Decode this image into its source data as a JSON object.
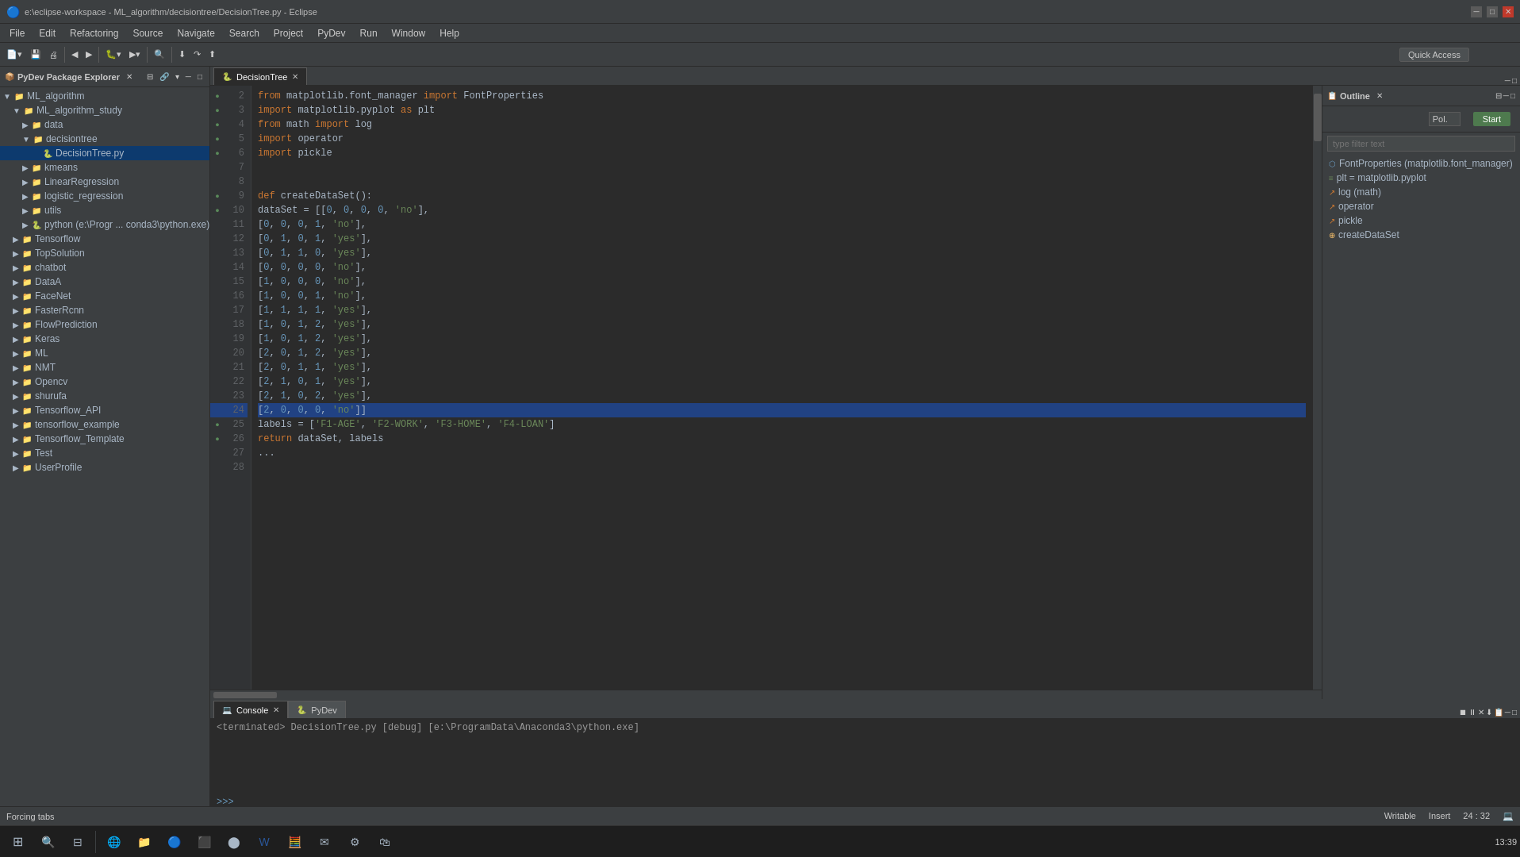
{
  "window": {
    "title": "e:\\eclipse-workspace - ML_algorithm/decisiontree/DecisionTree.py - Eclipse",
    "icon": "eclipse-icon"
  },
  "titlebar": {
    "text": "e:\\eclipse-workspace - ML_algorithm/decisiontree/DecisionTree.py - Eclipse"
  },
  "menubar": {
    "items": [
      "File",
      "Edit",
      "Refactoring",
      "Source",
      "Navigate",
      "Search",
      "Project",
      "PyDev",
      "Run",
      "Window",
      "Help"
    ]
  },
  "tabs": {
    "editor_tab": "DecisionTree",
    "console_tab": "Console",
    "pydev_tab": "PyDev"
  },
  "quick_access": {
    "label": "Quick Access",
    "placeholder": "Quick Access"
  },
  "sidebar": {
    "title": "PyDev Package Explorer",
    "items": [
      {
        "label": "ML_algorithm",
        "level": 1,
        "type": "folder",
        "expanded": true
      },
      {
        "label": "ML_algorithm_study",
        "level": 2,
        "type": "folder",
        "expanded": true
      },
      {
        "label": "data",
        "level": 3,
        "type": "folder",
        "expanded": false
      },
      {
        "label": "decisiontree",
        "level": 3,
        "type": "folder",
        "expanded": true
      },
      {
        "label": "DecisionTree.py",
        "level": 4,
        "type": "pyfile",
        "selected": true
      },
      {
        "label": "kmeans",
        "level": 3,
        "type": "folder",
        "expanded": false
      },
      {
        "label": "LinearRegression",
        "level": 3,
        "type": "folder",
        "expanded": false
      },
      {
        "label": "logistic_regression",
        "level": 3,
        "type": "folder",
        "expanded": false
      },
      {
        "label": "utils",
        "level": 3,
        "type": "folder",
        "expanded": false
      },
      {
        "label": "python (e:\\Progr ... conda3\\python.exe)",
        "level": 3,
        "type": "python",
        "expanded": false
      },
      {
        "label": "Tensorflow",
        "level": 2,
        "type": "folder",
        "expanded": false
      },
      {
        "label": "TopSolution",
        "level": 2,
        "type": "folder",
        "expanded": false
      },
      {
        "label": "chatbot",
        "level": 2,
        "type": "folder",
        "expanded": false
      },
      {
        "label": "DataA",
        "level": 2,
        "type": "folder",
        "expanded": false
      },
      {
        "label": "FaceNet",
        "level": 2,
        "type": "folder",
        "expanded": false
      },
      {
        "label": "FasterRcnn",
        "level": 2,
        "type": "folder",
        "expanded": false
      },
      {
        "label": "FlowPrediction",
        "level": 2,
        "type": "folder",
        "expanded": false
      },
      {
        "label": "Keras",
        "level": 2,
        "type": "folder",
        "expanded": false
      },
      {
        "label": "ML",
        "level": 2,
        "type": "folder",
        "expanded": false
      },
      {
        "label": "NMT",
        "level": 2,
        "type": "folder",
        "expanded": false
      },
      {
        "label": "Opencv",
        "level": 2,
        "type": "folder",
        "expanded": false
      },
      {
        "label": "shurufa",
        "level": 2,
        "type": "folder",
        "expanded": false
      },
      {
        "label": "Tensorflow_API",
        "level": 2,
        "type": "folder",
        "expanded": false
      },
      {
        "label": "tensorflow_example",
        "level": 2,
        "type": "folder",
        "expanded": false
      },
      {
        "label": "Tensorflow_Template",
        "level": 2,
        "type": "folder",
        "expanded": false
      },
      {
        "label": "Test",
        "level": 2,
        "type": "folder",
        "expanded": false
      },
      {
        "label": "UserProfile",
        "level": 2,
        "type": "folder",
        "expanded": false
      }
    ]
  },
  "outline": {
    "title": "Outline",
    "filter_placeholder": "type filter text",
    "items": [
      {
        "label": "FontProperties (matplotlib.font_manager)",
        "type": "class",
        "icon": "F"
      },
      {
        "label": "plt = matplotlib.pyplot",
        "type": "var",
        "icon": "="
      },
      {
        "label": "log (math)",
        "type": "import",
        "icon": "i"
      },
      {
        "label": "operator",
        "type": "import",
        "icon": "i"
      },
      {
        "label": "pickle",
        "type": "import",
        "icon": "i"
      },
      {
        "label": "createDataSet",
        "type": "function",
        "icon": "f"
      }
    ],
    "pol_value": "Pol.",
    "start_label": "Start"
  },
  "code": {
    "lines": [
      {
        "num": 2,
        "content": "from matplotlib.font_manager import FontProperties",
        "gutter": "b"
      },
      {
        "num": 3,
        "content": "import matplotlib.pyplot as plt",
        "gutter": "b"
      },
      {
        "num": 4,
        "content": "from math import log",
        "gutter": "b"
      },
      {
        "num": 5,
        "content": "import operator",
        "gutter": "b"
      },
      {
        "num": 6,
        "content": "import pickle",
        "gutter": "b"
      },
      {
        "num": 7,
        "content": "",
        "gutter": ""
      },
      {
        "num": 8,
        "content": "",
        "gutter": ""
      },
      {
        "num": 9,
        "content": "def createDataSet():",
        "gutter": "b"
      },
      {
        "num": 10,
        "content": "    dataSet = [[0, 0, 0, 0, 'no'],",
        "gutter": "b"
      },
      {
        "num": 11,
        "content": "                [0, 0, 0, 1, 'no'],",
        "gutter": ""
      },
      {
        "num": 12,
        "content": "                [0, 1, 0, 1, 'yes'],",
        "gutter": ""
      },
      {
        "num": 13,
        "content": "                [0, 1, 1, 0, 'yes'],",
        "gutter": ""
      },
      {
        "num": 14,
        "content": "                [0, 0, 0, 0, 'no'],",
        "gutter": ""
      },
      {
        "num": 15,
        "content": "                [1, 0, 0, 0, 'no'],",
        "gutter": ""
      },
      {
        "num": 16,
        "content": "                [1, 0, 0, 1, 'no'],",
        "gutter": ""
      },
      {
        "num": 17,
        "content": "                [1, 1, 1, 1, 'yes'],",
        "gutter": ""
      },
      {
        "num": 18,
        "content": "                [1, 0, 1, 2, 'yes'],",
        "gutter": ""
      },
      {
        "num": 19,
        "content": "                [1, 0, 1, 2, 'yes'],",
        "gutter": ""
      },
      {
        "num": 20,
        "content": "                [2, 0, 1, 2, 'yes'],",
        "gutter": ""
      },
      {
        "num": 21,
        "content": "                [2, 0, 1, 1, 'yes'],",
        "gutter": ""
      },
      {
        "num": 22,
        "content": "                [2, 1, 0, 1, 'yes'],",
        "gutter": ""
      },
      {
        "num": 23,
        "content": "                [2, 1, 0, 2, 'yes'],",
        "gutter": ""
      },
      {
        "num": 24,
        "content": "                [2, 0, 0, 0, 'no']]",
        "gutter": "",
        "highlighted": true
      },
      {
        "num": 25,
        "content": "    labels = ['F1-AGE', 'F2-WORK', 'F3-HOME', 'F4-LOAN']",
        "gutter": "b"
      },
      {
        "num": 26,
        "content": "    return dataSet, labels",
        "gutter": "b"
      },
      {
        "num": 27,
        "content": "    ...",
        "gutter": ""
      },
      {
        "num": 28,
        "content": "",
        "gutter": ""
      }
    ]
  },
  "console": {
    "terminated_text": "<terminated> DecisionTree.py [debug] [e:\\ProgramData\\Anaconda3\\python.exe]",
    "prompt": ">>>"
  },
  "statusbar": {
    "forcing_tabs": "Forcing tabs",
    "writable": "Writable",
    "insert": "Insert",
    "position": "24 : 32"
  }
}
